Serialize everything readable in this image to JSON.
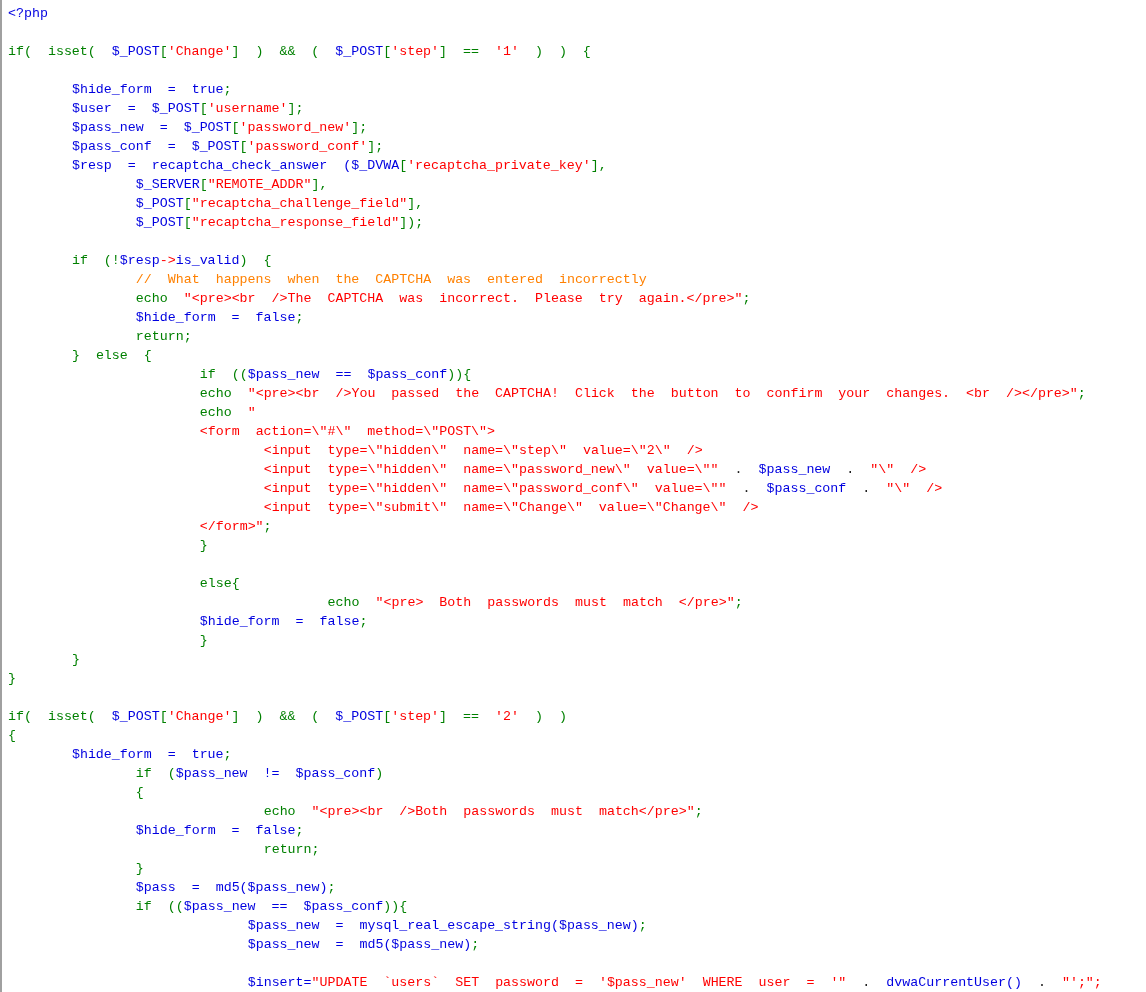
{
  "code_lines": [
    {
      "kind": "code",
      "tokens": [
        {
          "kind": "var",
          "text": "<?php"
        }
      ]
    },
    {
      "kind": "blank"
    },
    {
      "kind": "code",
      "tokens": [
        {
          "kind": "kw",
          "text": "if( isset( "
        },
        {
          "kind": "var",
          "text": "$_POST"
        },
        {
          "kind": "kw",
          "text": "["
        },
        {
          "kind": "str",
          "text": "'Change'"
        },
        {
          "kind": "kw",
          "text": "] ) && ( "
        },
        {
          "kind": "var",
          "text": "$_POST"
        },
        {
          "kind": "kw",
          "text": "["
        },
        {
          "kind": "str",
          "text": "'step'"
        },
        {
          "kind": "kw",
          "text": "] == "
        },
        {
          "kind": "str",
          "text": "'1'"
        },
        {
          "kind": "kw",
          "text": " ) ) {"
        }
      ]
    },
    {
      "kind": "blank"
    },
    {
      "kind": "code",
      "tokens": [
        {
          "kind": "var",
          "text": "\t$hide_form = true"
        },
        {
          "kind": "kw",
          "text": ";"
        }
      ]
    },
    {
      "kind": "code",
      "tokens": [
        {
          "kind": "var",
          "text": "\t$user = $_POST"
        },
        {
          "kind": "kw",
          "text": "["
        },
        {
          "kind": "str",
          "text": "'username'"
        },
        {
          "kind": "kw",
          "text": "];"
        }
      ]
    },
    {
      "kind": "code",
      "tokens": [
        {
          "kind": "var",
          "text": "\t$pass_new = $_POST"
        },
        {
          "kind": "kw",
          "text": "["
        },
        {
          "kind": "str",
          "text": "'password_new'"
        },
        {
          "kind": "kw",
          "text": "];"
        }
      ]
    },
    {
      "kind": "code",
      "tokens": [
        {
          "kind": "var",
          "text": "\t$pass_conf = $_POST"
        },
        {
          "kind": "kw",
          "text": "["
        },
        {
          "kind": "str",
          "text": "'password_conf'"
        },
        {
          "kind": "kw",
          "text": "];"
        }
      ]
    },
    {
      "kind": "code",
      "tokens": [
        {
          "kind": "var",
          "text": "\t$resp = recaptcha_check_answer ($_DVWA"
        },
        {
          "kind": "kw",
          "text": "["
        },
        {
          "kind": "str",
          "text": "'recaptcha_private_key'"
        },
        {
          "kind": "kw",
          "text": "],"
        }
      ]
    },
    {
      "kind": "code",
      "tokens": [
        {
          "kind": "var",
          "text": "\t\t$_SERVER"
        },
        {
          "kind": "kw",
          "text": "["
        },
        {
          "kind": "str",
          "text": "\"REMOTE_ADDR\""
        },
        {
          "kind": "kw",
          "text": "],"
        }
      ]
    },
    {
      "kind": "code",
      "tokens": [
        {
          "kind": "var",
          "text": "\t\t$_POST"
        },
        {
          "kind": "kw",
          "text": "["
        },
        {
          "kind": "str",
          "text": "\"recaptcha_challenge_field\""
        },
        {
          "kind": "kw",
          "text": "],"
        }
      ]
    },
    {
      "kind": "code",
      "tokens": [
        {
          "kind": "var",
          "text": "\t\t$_POST"
        },
        {
          "kind": "kw",
          "text": "["
        },
        {
          "kind": "str",
          "text": "\"recaptcha_response_field\""
        },
        {
          "kind": "kw",
          "text": "]);"
        }
      ]
    },
    {
      "kind": "blank"
    },
    {
      "kind": "code",
      "tokens": [
        {
          "kind": "kw",
          "text": "\tif (!"
        },
        {
          "kind": "var",
          "text": "$resp"
        },
        {
          "kind": "str",
          "text": "->"
        },
        {
          "kind": "var",
          "text": "is_valid"
        },
        {
          "kind": "kw",
          "text": ") {"
        }
      ]
    },
    {
      "kind": "code",
      "tokens": [
        {
          "kind": "cmt",
          "text": "\t\t// What happens when the CAPTCHA was entered incorrectly"
        }
      ]
    },
    {
      "kind": "code",
      "tokens": [
        {
          "kind": "kw",
          "text": "\t\techo "
        },
        {
          "kind": "str",
          "text": "\"<pre><br />The CAPTCHA was incorrect. Please try again.</pre>\""
        },
        {
          "kind": "kw",
          "text": ";"
        }
      ]
    },
    {
      "kind": "code",
      "tokens": [
        {
          "kind": "var",
          "text": "\t\t$hide_form = false"
        },
        {
          "kind": "kw",
          "text": ";"
        }
      ]
    },
    {
      "kind": "code",
      "tokens": [
        {
          "kind": "kw",
          "text": "\t\treturn;"
        }
      ]
    },
    {
      "kind": "code",
      "tokens": [
        {
          "kind": "kw",
          "text": "\t} else {"
        }
      ]
    },
    {
      "kind": "code",
      "tokens": [
        {
          "kind": "kw",
          "text": "\t\t\tif (("
        },
        {
          "kind": "var",
          "text": "$pass_new == $pass_conf"
        },
        {
          "kind": "kw",
          "text": ")){"
        }
      ]
    },
    {
      "kind": "code",
      "tokens": [
        {
          "kind": "kw",
          "text": "\t\t\techo "
        },
        {
          "kind": "str",
          "text": "\"<pre><br />You passed the CAPTCHA! Click the button to confirm your changes. <br /></pre>\""
        },
        {
          "kind": "kw",
          "text": ";"
        }
      ]
    },
    {
      "kind": "code",
      "tokens": [
        {
          "kind": "kw",
          "text": "\t\t\techo "
        },
        {
          "kind": "str",
          "text": "\""
        }
      ]
    },
    {
      "kind": "code",
      "tokens": [
        {
          "kind": "str",
          "text": "\t\t\t<form action=\\\"#\\\" method=\\\"POST\\\">"
        }
      ]
    },
    {
      "kind": "code",
      "tokens": [
        {
          "kind": "str",
          "text": "\t\t\t\t<input type=\\\"hidden\\\" name=\\\"step\\\" value=\\\"2\\\" />"
        }
      ]
    },
    {
      "kind": "code",
      "tokens": [
        {
          "kind": "str",
          "text": "\t\t\t\t<input type=\\\"hidden\\\" name=\\\"password_new\\\" value=\\\"\""
        },
        {
          "kind": "op",
          "text": " . "
        },
        {
          "kind": "var",
          "text": "$pass_new"
        },
        {
          "kind": "op",
          "text": " . "
        },
        {
          "kind": "str",
          "text": "\"\\\" />"
        }
      ]
    },
    {
      "kind": "code",
      "tokens": [
        {
          "kind": "str",
          "text": "\t\t\t\t<input type=\\\"hidden\\\" name=\\\"password_conf\\\" value=\\\"\""
        },
        {
          "kind": "op",
          "text": " . "
        },
        {
          "kind": "var",
          "text": "$pass_conf"
        },
        {
          "kind": "op",
          "text": " . "
        },
        {
          "kind": "str",
          "text": "\"\\\" />"
        }
      ]
    },
    {
      "kind": "code",
      "tokens": [
        {
          "kind": "str",
          "text": "\t\t\t\t<input type=\\\"submit\\\" name=\\\"Change\\\" value=\\\"Change\\\" />"
        }
      ]
    },
    {
      "kind": "code",
      "tokens": [
        {
          "kind": "str",
          "text": "\t\t\t</form>\""
        },
        {
          "kind": "kw",
          "text": ";"
        }
      ]
    },
    {
      "kind": "code",
      "tokens": [
        {
          "kind": "kw",
          "text": "\t\t\t}"
        }
      ]
    },
    {
      "kind": "blank"
    },
    {
      "kind": "code",
      "tokens": [
        {
          "kind": "kw",
          "text": "\t\t\telse{"
        }
      ]
    },
    {
      "kind": "code",
      "tokens": [
        {
          "kind": "kw",
          "text": "\t\t\t\t\techo "
        },
        {
          "kind": "str",
          "text": "\"<pre> Both passwords must match </pre>\""
        },
        {
          "kind": "kw",
          "text": ";"
        }
      ]
    },
    {
      "kind": "code",
      "tokens": [
        {
          "kind": "var",
          "text": "\t\t\t$hide_form = false"
        },
        {
          "kind": "kw",
          "text": ";"
        }
      ]
    },
    {
      "kind": "code",
      "tokens": [
        {
          "kind": "kw",
          "text": "\t\t\t}"
        }
      ]
    },
    {
      "kind": "code",
      "tokens": [
        {
          "kind": "kw",
          "text": "\t}"
        }
      ]
    },
    {
      "kind": "code",
      "tokens": [
        {
          "kind": "kw",
          "text": "}"
        }
      ]
    },
    {
      "kind": "blank"
    },
    {
      "kind": "code",
      "tokens": [
        {
          "kind": "kw",
          "text": "if( isset( "
        },
        {
          "kind": "var",
          "text": "$_POST"
        },
        {
          "kind": "kw",
          "text": "["
        },
        {
          "kind": "str",
          "text": "'Change'"
        },
        {
          "kind": "kw",
          "text": "] ) && ( "
        },
        {
          "kind": "var",
          "text": "$_POST"
        },
        {
          "kind": "kw",
          "text": "["
        },
        {
          "kind": "str",
          "text": "'step'"
        },
        {
          "kind": "kw",
          "text": "] == "
        },
        {
          "kind": "str",
          "text": "'2'"
        },
        {
          "kind": "kw",
          "text": " ) )"
        }
      ]
    },
    {
      "kind": "code",
      "tokens": [
        {
          "kind": "kw",
          "text": "{"
        }
      ]
    },
    {
      "kind": "code",
      "tokens": [
        {
          "kind": "var",
          "text": "\t$hide_form = true"
        },
        {
          "kind": "kw",
          "text": ";"
        }
      ]
    },
    {
      "kind": "code",
      "tokens": [
        {
          "kind": "kw",
          "text": "\t\tif ("
        },
        {
          "kind": "var",
          "text": "$pass_new != $pass_conf"
        },
        {
          "kind": "kw",
          "text": ")"
        }
      ]
    },
    {
      "kind": "code",
      "tokens": [
        {
          "kind": "kw",
          "text": "\t\t{"
        }
      ]
    },
    {
      "kind": "code",
      "tokens": [
        {
          "kind": "kw",
          "text": "\t\t\t\techo "
        },
        {
          "kind": "str",
          "text": "\"<pre><br />Both passwords must match</pre>\""
        },
        {
          "kind": "kw",
          "text": ";"
        }
      ]
    },
    {
      "kind": "code",
      "tokens": [
        {
          "kind": "var",
          "text": "\t\t$hide_form = false"
        },
        {
          "kind": "kw",
          "text": ";"
        }
      ]
    },
    {
      "kind": "code",
      "tokens": [
        {
          "kind": "kw",
          "text": "\t\t\t\treturn;"
        }
      ]
    },
    {
      "kind": "code",
      "tokens": [
        {
          "kind": "kw",
          "text": "\t\t}"
        }
      ]
    },
    {
      "kind": "code",
      "tokens": [
        {
          "kind": "var",
          "text": "\t\t$pass = md5($pass_new)"
        },
        {
          "kind": "kw",
          "text": ";"
        }
      ]
    },
    {
      "kind": "code",
      "tokens": [
        {
          "kind": "kw",
          "text": "\t\tif (("
        },
        {
          "kind": "var",
          "text": "$pass_new == $pass_conf"
        },
        {
          "kind": "kw",
          "text": ")){"
        }
      ]
    },
    {
      "kind": "code",
      "tokens": [
        {
          "kind": "var",
          "text": "\t\t\t   $pass_new = mysql_real_escape_string($pass_new)"
        },
        {
          "kind": "kw",
          "text": ";"
        }
      ]
    },
    {
      "kind": "code",
      "tokens": [
        {
          "kind": "var",
          "text": "\t\t\t   $pass_new = md5($pass_new)"
        },
        {
          "kind": "kw",
          "text": ";"
        }
      ]
    },
    {
      "kind": "blank"
    },
    {
      "kind": "code",
      "tokens": [
        {
          "kind": "var",
          "text": "\t\t\t   $insert="
        },
        {
          "kind": "str",
          "text": "\"UPDATE `users` SET password = '$pass_new' WHERE user = '\""
        },
        {
          "kind": "op",
          "text": " . "
        },
        {
          "kind": "var",
          "text": "dvwaCurrentUser()"
        },
        {
          "kind": "op",
          "text": " . "
        },
        {
          "kind": "str",
          "text": "\"';\";"
        }
      ]
    }
  ]
}
